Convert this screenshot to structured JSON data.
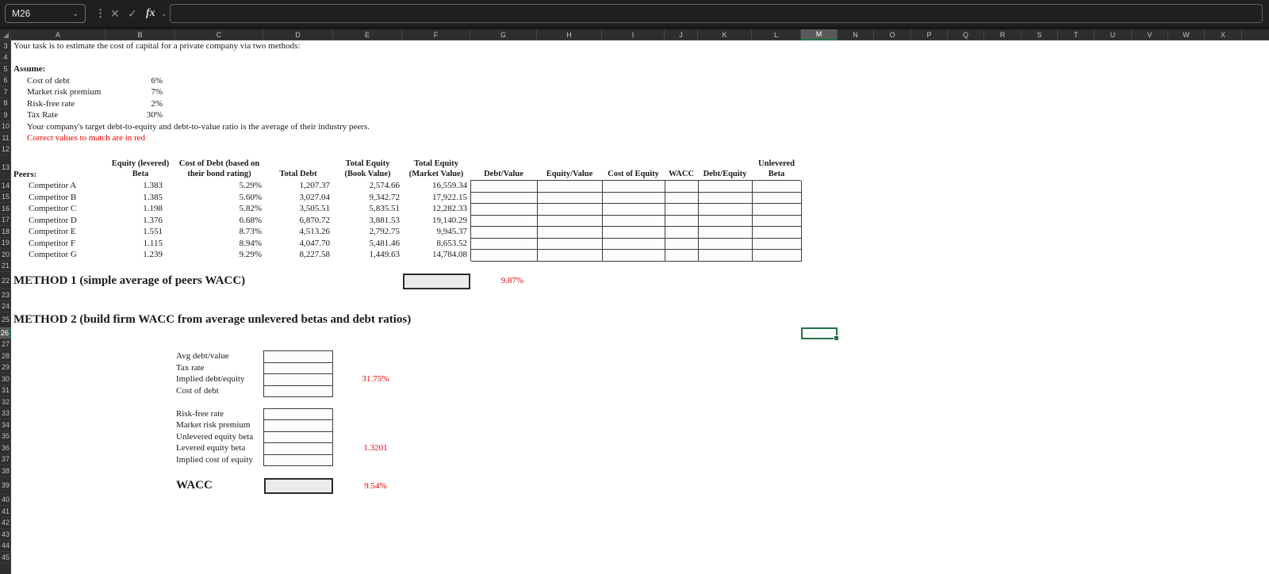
{
  "toolbar": {
    "name_box": "M26",
    "formula": "",
    "icons": {
      "name_box_dropdown": "⌄",
      "more": "⋮",
      "cancel": "✕",
      "enter": "✓",
      "insert_function": "fx",
      "fx_dropdown": "⌄"
    }
  },
  "grid": {
    "columns": [
      "A",
      "B",
      "C",
      "D",
      "E",
      "F",
      "G",
      "H",
      "I",
      "J",
      "K",
      "L",
      "M",
      "N",
      "O",
      "P",
      "Q",
      "R",
      "S",
      "T",
      "U",
      "V",
      "W",
      "X"
    ],
    "selected_column": "M",
    "selected_row": "26",
    "first_row": 3,
    "last_row": 45,
    "selection_color": "#217346"
  },
  "sheet": {
    "red_color": "#ee0000",
    "intro": "Your task is to estimate the cost of capital for a private company via two methods:",
    "assume_heading": "Assume:",
    "assumptions": [
      {
        "label": "Cost of debt",
        "value": "6%"
      },
      {
        "label": "Market risk premium",
        "value": "7%"
      },
      {
        "label": "Risk-free rate",
        "value": "2%"
      },
      {
        "label": "Tax Rate",
        "value": "30%"
      }
    ],
    "target_note": "Your company's target debt-to-equity and debt-to-value ratio is the average of their industry peers.",
    "red_note": "Correct values to match are in red"
  },
  "peer_table": {
    "corner_label": "Peers:",
    "col_headers": {
      "beta_1": "Equity (levered)",
      "beta_2": "Beta",
      "cod_1": "Cost of Debt (based on",
      "cod_2": "their bond rating)",
      "debt": "Total Debt",
      "book_1": "Total Equity",
      "book_2": "(Book Value)",
      "mkt_1": "Total Equity",
      "mkt_2": "(Market Value)",
      "dv": "Debt/Value",
      "ev": "Equity/Value",
      "coe": "Cost of Equity",
      "wacc": "WACC",
      "de": "Debt/Equity",
      "ub_1": "Unlevered",
      "ub_2": "Beta"
    },
    "rows": [
      {
        "name": "Competitor A",
        "beta": "1.383",
        "cod": "5.29%",
        "debt": "1,207.37",
        "book": "2,574.66",
        "mkt": "16,559.34"
      },
      {
        "name": "Competitor B",
        "beta": "1.385",
        "cod": "5.60%",
        "debt": "3,027.04",
        "book": "9,342.72",
        "mkt": "17,922.15"
      },
      {
        "name": "Competitor C",
        "beta": "1.198",
        "cod": "5.82%",
        "debt": "3,505.51",
        "book": "5,835.51",
        "mkt": "12,282.33"
      },
      {
        "name": "Competitor D",
        "beta": "1.376",
        "cod": "6.68%",
        "debt": "6,870.72",
        "book": "3,881.53",
        "mkt": "19,140.29"
      },
      {
        "name": "Competitor E",
        "beta": "1.551",
        "cod": "8.73%",
        "debt": "4,513.26",
        "book": "2,792.75",
        "mkt": "9,945.37"
      },
      {
        "name": "Competitor F",
        "beta": "1.115",
        "cod": "8.94%",
        "debt": "4,047.70",
        "book": "5,481.46",
        "mkt": "8,653.52"
      },
      {
        "name": "Competitor G",
        "beta": "1.239",
        "cod": "9.29%",
        "debt": "8,227.58",
        "book": "1,449.63",
        "mkt": "14,784.08"
      }
    ]
  },
  "method1": {
    "title": "METHOD 1 (simple average of peers WACC)",
    "target_value": "9.87%"
  },
  "method2": {
    "title": "METHOD 2 (build firm WACC from average unlevered betas and debt ratios)",
    "group1_labels": [
      "Avg debt/value",
      "Tax rate",
      "Implied debt/equity",
      "Cost of debt"
    ],
    "group1_hint": "31.75%",
    "group2_labels": [
      "Risk-free rate",
      "Market risk premium",
      "Unlevered equity beta",
      "Levered equity beta",
      "Implied cost of equity"
    ],
    "group2_hint": "1.3201",
    "wacc_label": "WACC",
    "wacc_hint": "9.54%"
  }
}
